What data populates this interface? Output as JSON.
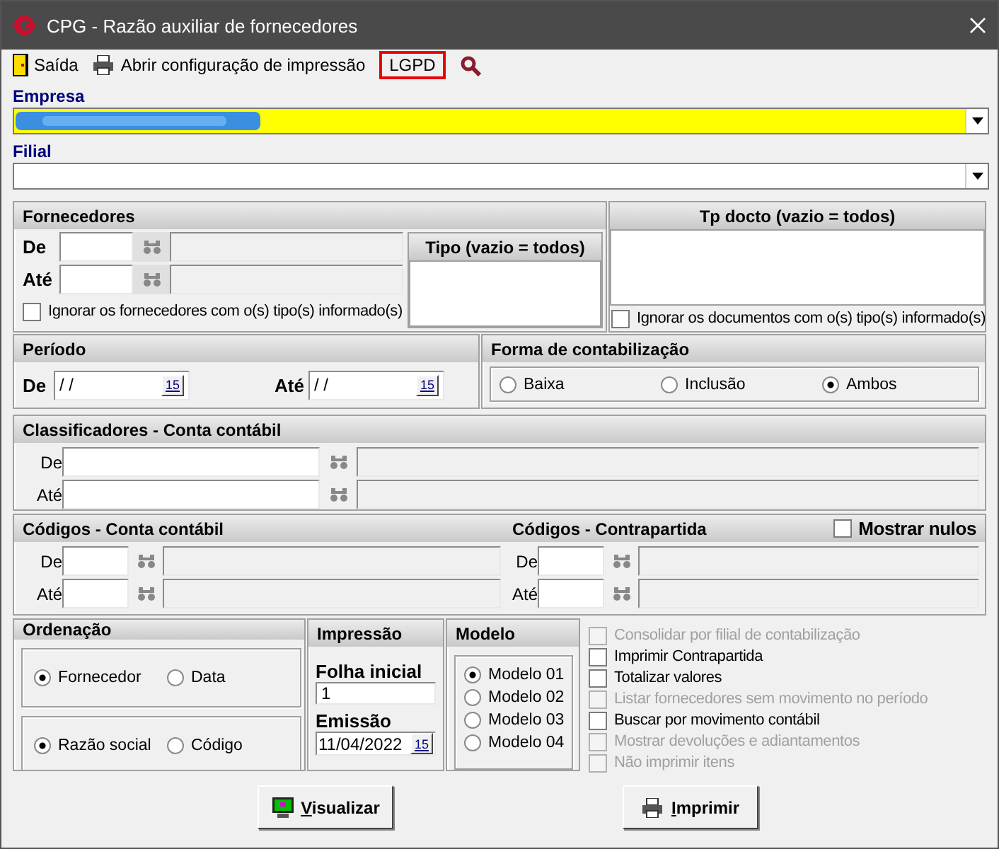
{
  "window": {
    "title": "CPG - Razão auxiliar de fornecedores"
  },
  "toolbar": [
    {
      "kind": "exit",
      "label": "Saída",
      "outlined": false
    },
    {
      "kind": "print",
      "label": "Abrir configuração de impressão",
      "outlined": false
    },
    {
      "kind": "text",
      "label": "LGPD",
      "outlined": true
    },
    {
      "kind": "search",
      "outlined": false
    }
  ],
  "empresa": {
    "label": "Empresa",
    "highlighted": true,
    "redacted": true
  },
  "filial": {
    "label": "Filial",
    "highlighted": false
  },
  "fornecedores": {
    "title": "Fornecedores",
    "rows": [
      {
        "label": "De"
      },
      {
        "label": "Até"
      }
    ],
    "ignore": {
      "label": "Ignorar os fornecedores com o(s) tipo(s) informado(s)",
      "checked": false
    },
    "tipo_title": "Tipo (vazio = todos)"
  },
  "tp_docto": {
    "title": "Tp docto (vazio = todos)",
    "ignore": {
      "label": "Ignorar os documentos com o(s) tipo(s) informado(s)",
      "checked": false
    }
  },
  "periodo": {
    "title": "Período",
    "fields": [
      {
        "label": "De",
        "value": "/ /",
        "calendar": "15"
      },
      {
        "label": "Até",
        "value": "/ /",
        "calendar": "15"
      }
    ]
  },
  "forma": {
    "title": "Forma de contabilização",
    "options": [
      {
        "label": "Baixa",
        "selected": false
      },
      {
        "label": "Inclusão",
        "selected": false
      },
      {
        "label": "Ambos",
        "selected": true
      }
    ]
  },
  "classificadores": {
    "title": "Classificadores - Conta contábil",
    "rows": [
      {
        "label": "De"
      },
      {
        "label": "Até"
      }
    ]
  },
  "codigos": {
    "title": "Códigos - Conta contábil",
    "contra_title": "Códigos - Contrapartida",
    "mostrar_nulos": {
      "label": "Mostrar nulos",
      "checked": false
    },
    "rows": [
      {
        "label": "De"
      },
      {
        "label": "Até"
      }
    ],
    "contra_rows": [
      {
        "label": "De"
      },
      {
        "label": "Até"
      }
    ]
  },
  "ordenacao": {
    "title": "Ordenação",
    "groups": [
      [
        {
          "label": "Fornecedor",
          "selected": true
        },
        {
          "label": "Data",
          "selected": false
        }
      ],
      [
        {
          "label": "Razão social",
          "selected": true
        },
        {
          "label": "Código",
          "selected": false
        }
      ]
    ]
  },
  "impressao": {
    "title": "Impressão",
    "folha_label": "Folha inicial",
    "folha_value": "1",
    "emissao_label": "Emissão",
    "emissao_value": "11/04/2022",
    "calendar": "15"
  },
  "modelo": {
    "title": "Modelo",
    "options": [
      {
        "label": "Modelo 01",
        "selected": true
      },
      {
        "label": "Modelo 02",
        "selected": false
      },
      {
        "label": "Modelo 03",
        "selected": false
      },
      {
        "label": "Modelo 04",
        "selected": false
      }
    ]
  },
  "options": [
    {
      "label": "Consolidar por filial de contabilização",
      "checked": false,
      "disabled": true
    },
    {
      "label": "Imprimir Contrapartida",
      "checked": false,
      "disabled": false
    },
    {
      "label": "Totalizar valores",
      "checked": false,
      "disabled": false
    },
    {
      "label": "Listar fornecedores sem movimento no período",
      "checked": false,
      "disabled": true
    },
    {
      "label": "Buscar por movimento contábil",
      "checked": false,
      "disabled": false
    },
    {
      "label": "Mostrar devoluções e adiantamentos",
      "checked": false,
      "disabled": true
    },
    {
      "label": "Não imprimir itens",
      "checked": false,
      "disabled": true
    }
  ],
  "buttons": [
    {
      "kind": "preview",
      "label": "Visualizar",
      "mnemonic_underlined": true
    },
    {
      "kind": "print",
      "label": "Imprimir",
      "mnemonic_underlined": true
    }
  ]
}
